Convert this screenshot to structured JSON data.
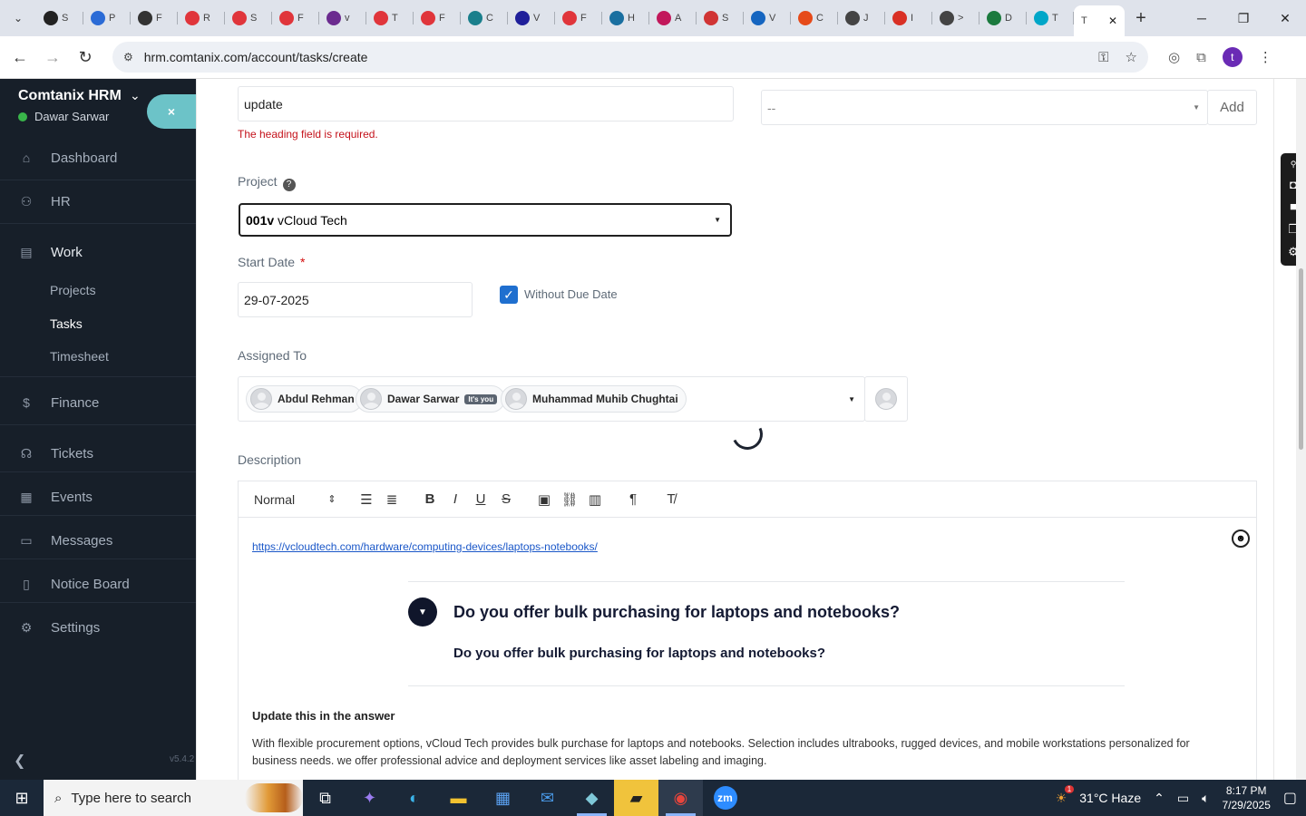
{
  "browser": {
    "tabs": [
      {
        "label": "S",
        "color": "#222222"
      },
      {
        "label": "P",
        "color": "#2b6bd6"
      },
      {
        "label": "F",
        "color": "#333333"
      },
      {
        "label": "R",
        "color": "#e0353b"
      },
      {
        "label": "S",
        "color": "#e0353b"
      },
      {
        "label": "F",
        "color": "#e0353b"
      },
      {
        "label": "v",
        "color": "#6b2b8f"
      },
      {
        "label": "T",
        "color": "#e0353b"
      },
      {
        "label": "F",
        "color": "#e0353b"
      },
      {
        "label": "C",
        "color": "#1a7f8c"
      },
      {
        "label": "V",
        "color": "#1f1f9a"
      },
      {
        "label": "F",
        "color": "#e0353b"
      },
      {
        "label": "H",
        "color": "#1a6fa0"
      },
      {
        "label": "A",
        "color": "#c2185b"
      },
      {
        "label": "S",
        "color": "#d03434"
      },
      {
        "label": "V",
        "color": "#1565c0"
      },
      {
        "label": "C",
        "color": "#e64a19"
      },
      {
        "label": "J",
        "color": "#444444"
      },
      {
        "label": "I",
        "color": "#d93025"
      },
      {
        "label": ">",
        "color": "#444444"
      },
      {
        "label": "D",
        "color": "#1b7a3e"
      },
      {
        "label": "T",
        "color": "#00a6c8"
      }
    ],
    "active_tab": {
      "label": "T"
    },
    "url": "hrm.comtanix.com/account/tasks/create"
  },
  "sidebar": {
    "brand": "Comtanix HRM",
    "user": "Dawar Sarwar",
    "close_label": "×",
    "items": [
      {
        "label": "Dashboard",
        "icon": "home-icon"
      },
      {
        "label": "HR",
        "icon": "users-icon"
      },
      {
        "label": "Work",
        "icon": "briefcase-icon"
      },
      {
        "label": "Finance",
        "icon": "dollar-icon"
      },
      {
        "label": "Tickets",
        "icon": "headset-icon"
      },
      {
        "label": "Events",
        "icon": "calendar-icon"
      },
      {
        "label": "Messages",
        "icon": "message-icon"
      },
      {
        "label": "Notice Board",
        "icon": "clipboard-icon"
      },
      {
        "label": "Settings",
        "icon": "gear-icon"
      }
    ],
    "work_sub": [
      "Projects",
      "Tasks",
      "Timesheet"
    ],
    "version": "v5.4.2"
  },
  "form": {
    "heading_value": "update",
    "heading_error": "The heading field is required.",
    "category_value": "--",
    "add_label": "Add",
    "project_label": "Project",
    "project_code": "001v",
    "project_name": "vCloud Tech",
    "start_date_label": "Start Date",
    "start_date_value": "29-07-2025",
    "without_due_label": "Without Due Date",
    "assigned_label": "Assigned To",
    "assignees": [
      {
        "name": "Abdul Rehman",
        "you": ""
      },
      {
        "name": "Dawar Sarwar",
        "you": "It's you"
      },
      {
        "name": "Muhammad Muhib Chughtai",
        "you": ""
      }
    ],
    "description_label": "Description",
    "editor": {
      "format": "Normal",
      "link": "https://vcloudtech.com/hardware/computing-devices/laptops-notebooks/",
      "faq_question": "Do you offer bulk purchasing for laptops and notebooks?",
      "faq_answer_title": "Do you offer bulk purchasing for laptops and notebooks?",
      "update_note": "Update this in the answer",
      "para1": "With flexible procurement options, vCloud Tech provides bulk purchase for laptops and notebooks. Selection includes ultrabooks, rugged devices, and mobile workstations personalized for",
      "para2": "business needs. we offer professional advice and deployment services like asset labeling and imaging."
    }
  },
  "taskbar": {
    "search_placeholder": "Type here to search",
    "weather": "31°C  Haze",
    "weather_badge": "1",
    "time": "8:17 PM",
    "date": "7/29/2025"
  }
}
